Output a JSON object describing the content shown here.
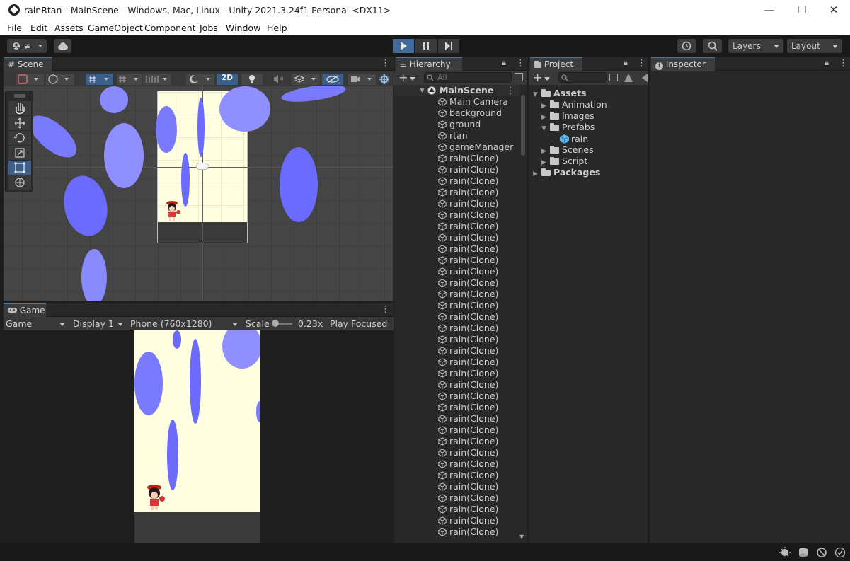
{
  "window": {
    "title": "rainRtan - MainScene - Windows, Mac, Linux - Unity 2021.3.24f1 Personal <DX11>",
    "min": "—",
    "max": "☐",
    "close": "✕"
  },
  "menu": [
    "File",
    "Edit",
    "Assets",
    "GameObject",
    "Component",
    "Jobs",
    "Window",
    "Help"
  ],
  "toolbar": {
    "layers_label": "Layers",
    "layout_label": "Layout"
  },
  "scene": {
    "tab_label": "Scene",
    "mode_2d": "2D"
  },
  "game": {
    "tab_label": "Game",
    "game_dropdown": "Game",
    "display_dropdown": "Display 1",
    "resolution_dropdown": "Phone (760x1280)",
    "scale_label": "Scale",
    "scale_value": "0.23x",
    "play_focused": "Play Focused"
  },
  "hierarchy": {
    "tab_label": "Hierarchy",
    "search_placeholder": "All",
    "scene_name": "MainScene",
    "items": [
      "Main Camera",
      "background",
      "ground",
      "rtan",
      "gameManager",
      "rain(Clone)",
      "rain(Clone)",
      "rain(Clone)",
      "rain(Clone)",
      "rain(Clone)",
      "rain(Clone)",
      "rain(Clone)",
      "rain(Clone)",
      "rain(Clone)",
      "rain(Clone)",
      "rain(Clone)",
      "rain(Clone)",
      "rain(Clone)",
      "rain(Clone)",
      "rain(Clone)",
      "rain(Clone)",
      "rain(Clone)",
      "rain(Clone)",
      "rain(Clone)",
      "rain(Clone)",
      "rain(Clone)",
      "rain(Clone)",
      "rain(Clone)",
      "rain(Clone)",
      "rain(Clone)",
      "rain(Clone)",
      "rain(Clone)",
      "rain(Clone)",
      "rain(Clone)",
      "rain(Clone)",
      "rain(Clone)",
      "rain(Clone)",
      "rain(Clone)",
      "rain(Clone)"
    ]
  },
  "project": {
    "tab_label": "Project",
    "assets_label": "Assets",
    "animation_label": "Animation",
    "images_label": "Images",
    "prefabs_label": "Prefabs",
    "rain_label": "rain",
    "scenes_label": "Scenes",
    "script_label": "Script",
    "packages_label": "Packages"
  },
  "inspector": {
    "tab_label": "Inspector"
  },
  "colors": {
    "rain": "#7a7aff",
    "rain_light": "#8f8fff",
    "background": "#fffee0",
    "ground": "#3a3a3a",
    "accent": "#3a79bb"
  },
  "icons": [
    "account-icon",
    "cloud-icon",
    "play-icon",
    "pause-icon",
    "step-icon",
    "history-icon",
    "search-icon",
    "hand-tool-icon",
    "move-tool-icon",
    "rotate-tool-icon",
    "scale-tool-icon",
    "rect-tool-icon",
    "transform-tool-icon",
    "gameobject-cube-icon",
    "folder-icon",
    "prefab-icon",
    "bug-icon",
    "database-icon",
    "ok-icon"
  ]
}
